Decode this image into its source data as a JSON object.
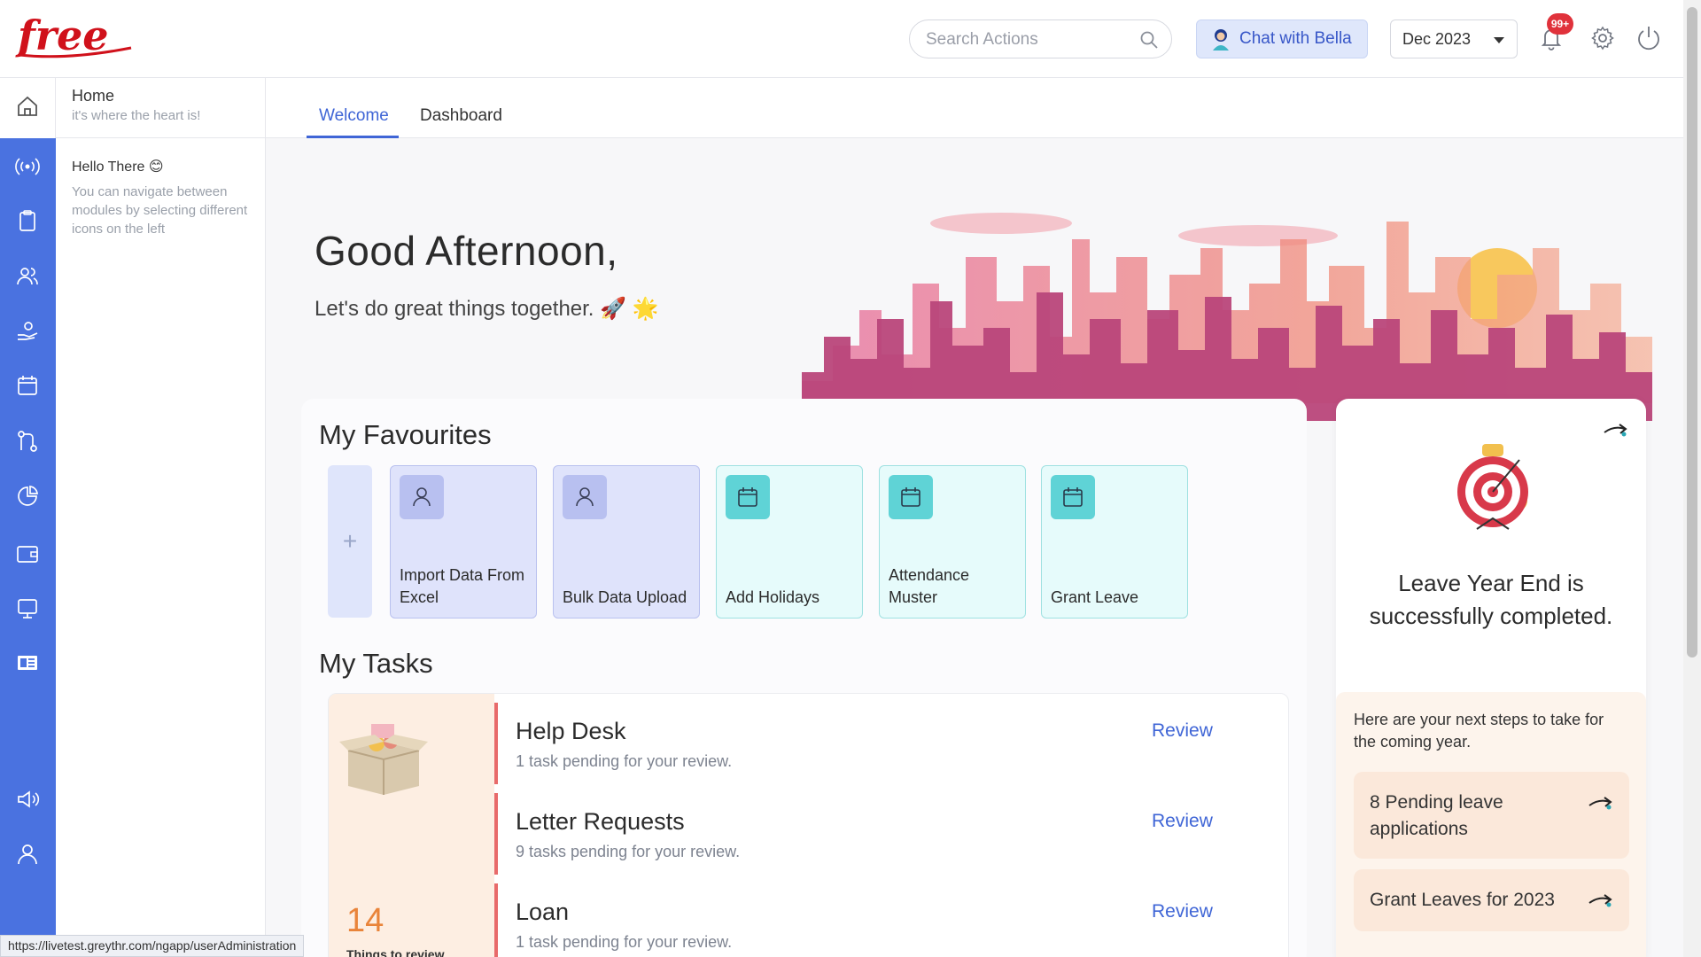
{
  "brand": {
    "logo_text": "free",
    "accent": "#4a72e0"
  },
  "header": {
    "search_placeholder": "Search Actions",
    "chat_label": "Chat with Bella",
    "month_selected": "Dec 2023",
    "notification_badge": "99+"
  },
  "sidebar": {
    "home_title": "Home",
    "home_sub": "it's where the heart is!",
    "hello": "Hello There 😊",
    "hint": "You can navigate between modules by selecting different icons on the left"
  },
  "rail_icons": [
    "home-icon",
    "broadcast-icon",
    "clipboard-icon",
    "people-icon",
    "hand-coin-icon",
    "calendar-icon",
    "workflow-icon",
    "pie-chart-icon",
    "wallet-icon",
    "monitor-icon",
    "document-icon",
    "megaphone-icon",
    "user-icon"
  ],
  "tabs": [
    {
      "label": "Welcome"
    },
    {
      "label": "Dashboard"
    }
  ],
  "welcome": {
    "greeting": "Good Afternoon,",
    "sub": "Let's do great things together. 🚀 🌟"
  },
  "favourites": {
    "title": "My Favourites",
    "add": "+",
    "items": [
      {
        "label": "Import Data From Excel",
        "icon": "user-icon",
        "color": "purple"
      },
      {
        "label": "Bulk Data Upload",
        "icon": "user-icon",
        "color": "purple"
      },
      {
        "label": "Add Holidays",
        "icon": "calendar-icon",
        "color": "teal"
      },
      {
        "label": "Attendance Muster",
        "icon": "calendar-icon",
        "color": "teal"
      },
      {
        "label": "Grant Leave",
        "icon": "calendar-icon",
        "color": "teal"
      }
    ]
  },
  "tasks": {
    "title": "My Tasks",
    "count": "14",
    "count_label": "Things to review",
    "items": [
      {
        "name": "Help Desk",
        "desc": "1 task pending for your review.",
        "action": "Review"
      },
      {
        "name": "Letter Requests",
        "desc": "9 tasks pending for your review.",
        "action": "Review"
      },
      {
        "name": "Loan",
        "desc": "1 task pending for your review.",
        "action": "Review"
      }
    ]
  },
  "leave_card": {
    "title": "Leave Year End is successfully completed.",
    "next_text": "Here are your next steps to take for the coming year.",
    "steps": [
      {
        "label": "8 Pending leave applications"
      },
      {
        "label": "Grant Leaves for 2023"
      }
    ]
  },
  "status_url": "https://livetest.greythr.com/ngapp/userAdministration"
}
